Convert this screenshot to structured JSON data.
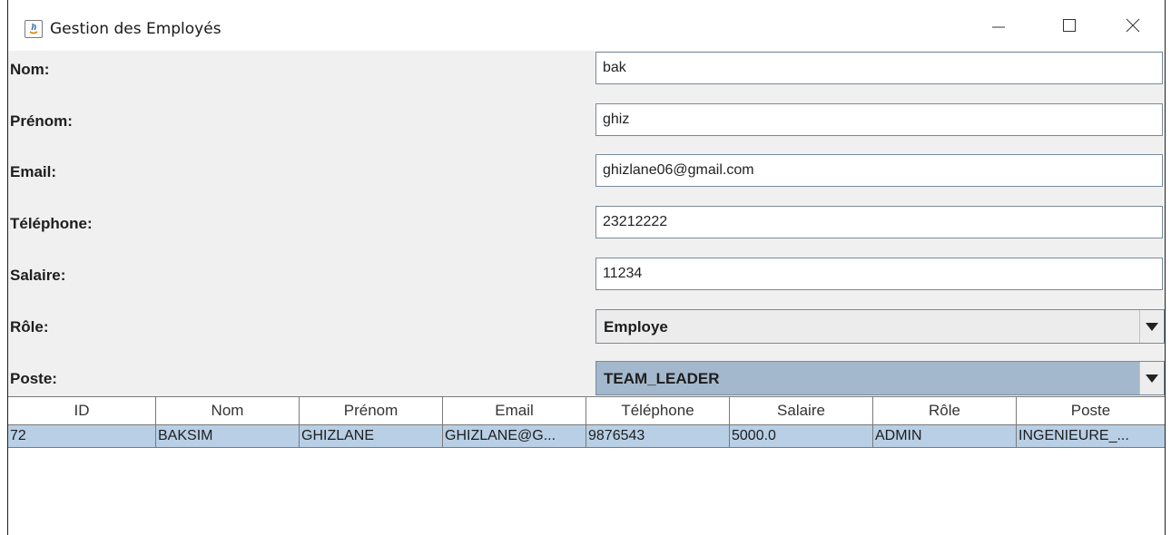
{
  "window": {
    "title": "Gestion des Employés"
  },
  "form": {
    "fields": [
      {
        "label": "Nom:",
        "value": "bak"
      },
      {
        "label": "Prénom:",
        "value": "ghiz"
      },
      {
        "label": "Email:",
        "value": "ghizlane06@gmail.com"
      },
      {
        "label": "Téléphone:",
        "value": "23212222"
      },
      {
        "label": "Salaire:",
        "value": "11234"
      }
    ],
    "role": {
      "label": "Rôle:",
      "selected": "Employe"
    },
    "poste": {
      "label": "Poste:",
      "selected": "TEAM_LEADER"
    }
  },
  "table": {
    "columns": [
      "ID",
      "Nom",
      "Prénom",
      "Email",
      "Téléphone",
      "Salaire",
      "Rôle",
      "Poste"
    ],
    "rows": [
      [
        "72",
        "BAKSIM",
        "GHIZLANE",
        "GHIZLANE@G...",
        "9876543",
        "5000.0",
        "ADMIN",
        "INGENIEURE_..."
      ]
    ]
  },
  "colors": {
    "window_bg": "#f0f0f0",
    "selection": "#b8cfe5",
    "combo_focus": "#a3b8cc"
  }
}
